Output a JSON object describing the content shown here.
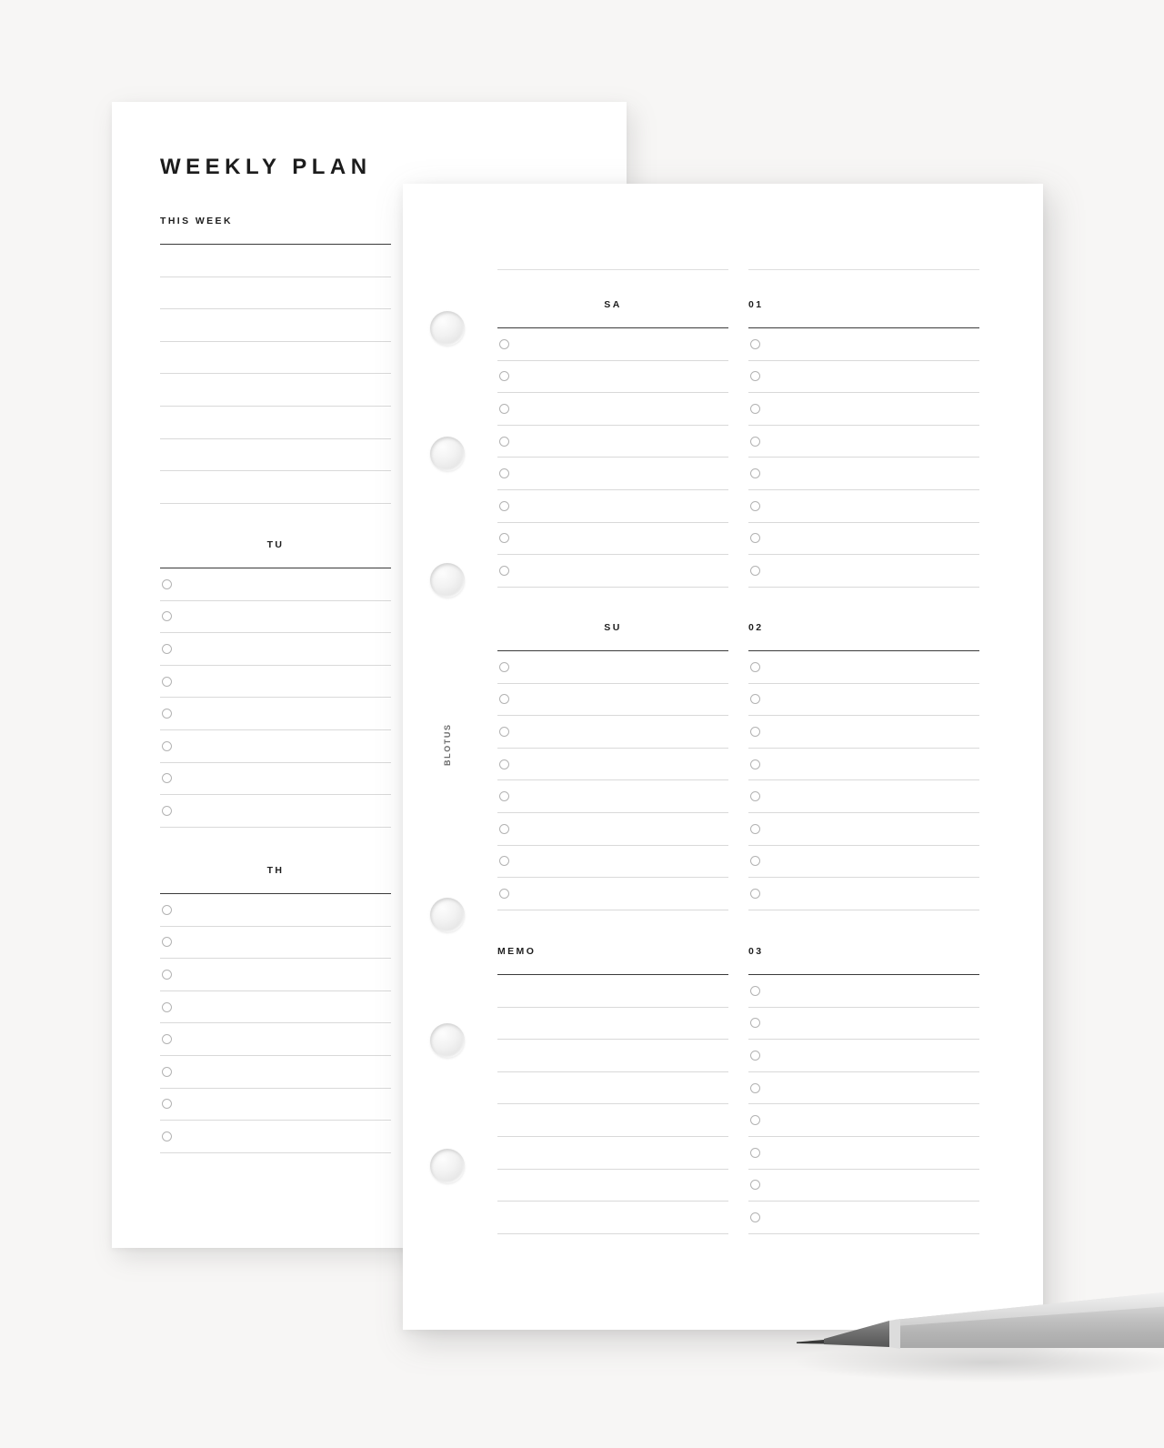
{
  "background_color": "#f7f6f5",
  "back_page": {
    "title": "WEEKLY PLAN",
    "sections": [
      {
        "label": "THIS WEEK",
        "align": "left",
        "rows": 8,
        "checkbox": false
      },
      {
        "label": "TU",
        "align": "center",
        "rows": 8,
        "checkbox": true
      },
      {
        "label": "TH",
        "align": "center",
        "rows": 8,
        "checkbox": true
      }
    ]
  },
  "front_page": {
    "brand_vertical": "BLOTUS",
    "ring_holes": 6,
    "left_column": [
      {
        "label": "SA",
        "align": "center",
        "rows": 8,
        "checkbox": true
      },
      {
        "label": "SU",
        "align": "center",
        "rows": 8,
        "checkbox": true
      },
      {
        "label": "MEMO",
        "align": "left",
        "rows": 8,
        "checkbox": false
      }
    ],
    "right_column": [
      {
        "label": "01",
        "align": "left",
        "rows": 8,
        "checkbox": true
      },
      {
        "label": "02",
        "align": "left",
        "rows": 8,
        "checkbox": true
      },
      {
        "label": "03",
        "align": "left",
        "rows": 8,
        "checkbox": true
      }
    ]
  },
  "decor": {
    "pencil": "mechanical-pencil",
    "pencil_body_color": "#c9c9c9",
    "pencil_tip_color": "#6e6e6e"
  },
  "style": {
    "rule_strong": "#3a3a3a",
    "rule_light": "#d9d9d9",
    "checkbox_border": "#b3b3b3",
    "text_color": "#1c1c1c"
  }
}
